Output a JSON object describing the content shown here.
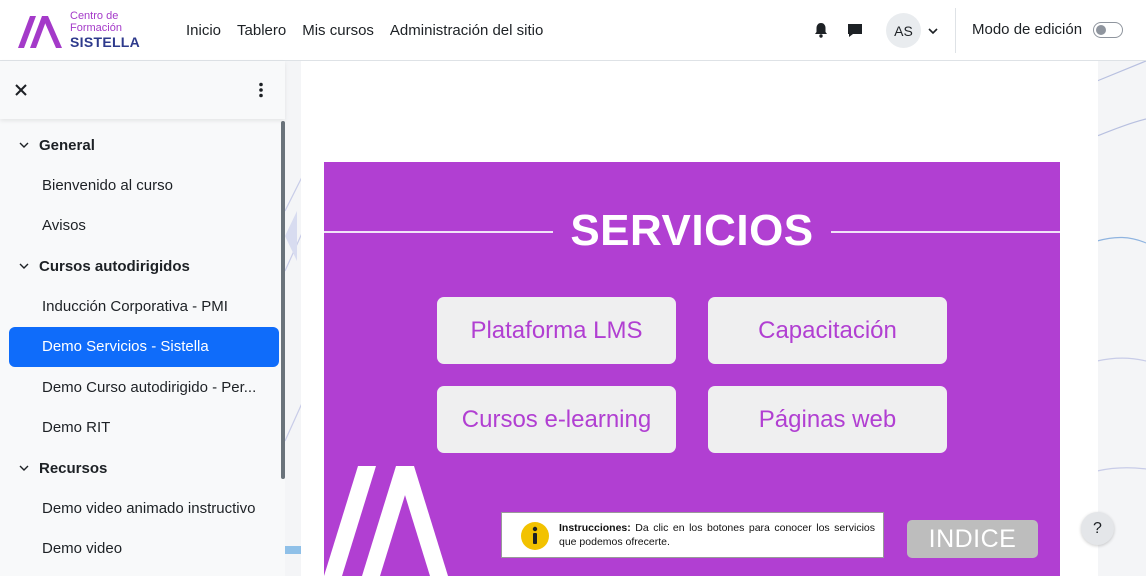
{
  "brand": {
    "line1": "Centro de",
    "line2": "Formación",
    "name": "SISTELLA"
  },
  "nav": {
    "links": [
      "Inicio",
      "Tablero",
      "Mis cursos",
      "Administración del sitio"
    ]
  },
  "user": {
    "initials": "AS"
  },
  "edit_mode": {
    "label": "Modo de edición",
    "enabled": false
  },
  "drawer": {
    "sections": [
      {
        "label": "General",
        "items": [
          "Bienvenido al curso",
          "Avisos"
        ]
      },
      {
        "label": "Cursos autodirigidos",
        "items": [
          "Inducción Corporativa - PMI",
          "Demo Servicios - Sistella",
          "Demo Curso autodirigido - Per...",
          "Demo RIT"
        ]
      },
      {
        "label": "Recursos",
        "items": [
          "Demo video animado instructivo",
          "Demo video"
        ]
      }
    ],
    "active_item": "Demo Servicios - Sistella"
  },
  "slide": {
    "heading": "SERVICIOS",
    "buttons": [
      "Plataforma LMS",
      "Capacitación",
      "Cursos e-learning",
      "Páginas web"
    ],
    "instructions_label": "Instrucciones:",
    "instructions_text": "Da clic en los botones para conocer los servicios que podemos ofrecerte.",
    "index_button": "INDICE"
  },
  "help": {
    "label": "?"
  },
  "colors": {
    "brand_purple": "#b13fd2",
    "brand_navy": "#2e3a8c",
    "active_blue": "#0f6cfa"
  }
}
